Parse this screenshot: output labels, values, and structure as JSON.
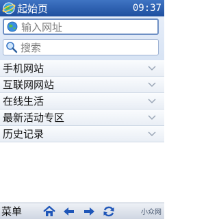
{
  "status_bar": {
    "title": "起始页",
    "time": "09:37",
    "logo_icon": "globe-icon"
  },
  "search": {
    "url_placeholder": "输入网址",
    "search_placeholder": "搜索",
    "url_icon": "globe-icon",
    "search_icon": "magnifier-icon"
  },
  "menu": {
    "items": [
      {
        "label": "手机网站"
      },
      {
        "label": "互联网网站"
      },
      {
        "label": "在线生活"
      },
      {
        "label": "最新活动专区"
      },
      {
        "label": "历史记录"
      }
    ],
    "chevron_icon": "chevron-down-icon"
  },
  "bottom_bar": {
    "menu_label": "菜单",
    "brand": "小众网",
    "buttons": [
      "home-icon",
      "back-arrow-icon",
      "forward-arrow-icon",
      "refresh-icon"
    ]
  },
  "colors": {
    "status_bar": "#2a5fb0",
    "accent_blue": "#1f56b8",
    "field_border": "#6e8fc4"
  }
}
